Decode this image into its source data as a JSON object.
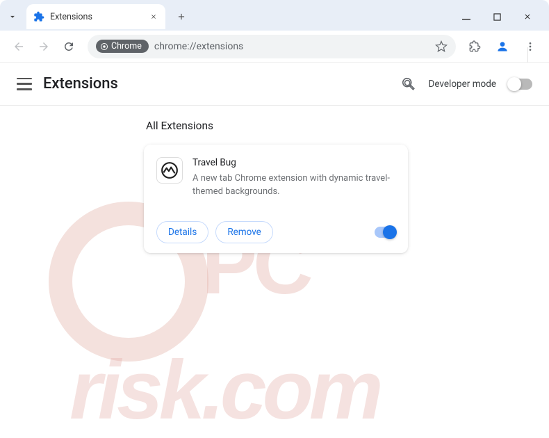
{
  "window": {
    "tab_title": "Extensions",
    "url": "chrome://extensions",
    "omnibox_label": "Chrome"
  },
  "header": {
    "title": "Extensions",
    "dev_mode_label": "Developer mode"
  },
  "main": {
    "section_title": "All Extensions",
    "extension": {
      "name": "Travel Bug",
      "description": "A new tab Chrome extension with dynamic travel-themed backgrounds.",
      "details_label": "Details",
      "remove_label": "Remove",
      "enabled": true
    }
  },
  "watermark": {
    "line1": "PC",
    "line2": "risk.com"
  }
}
